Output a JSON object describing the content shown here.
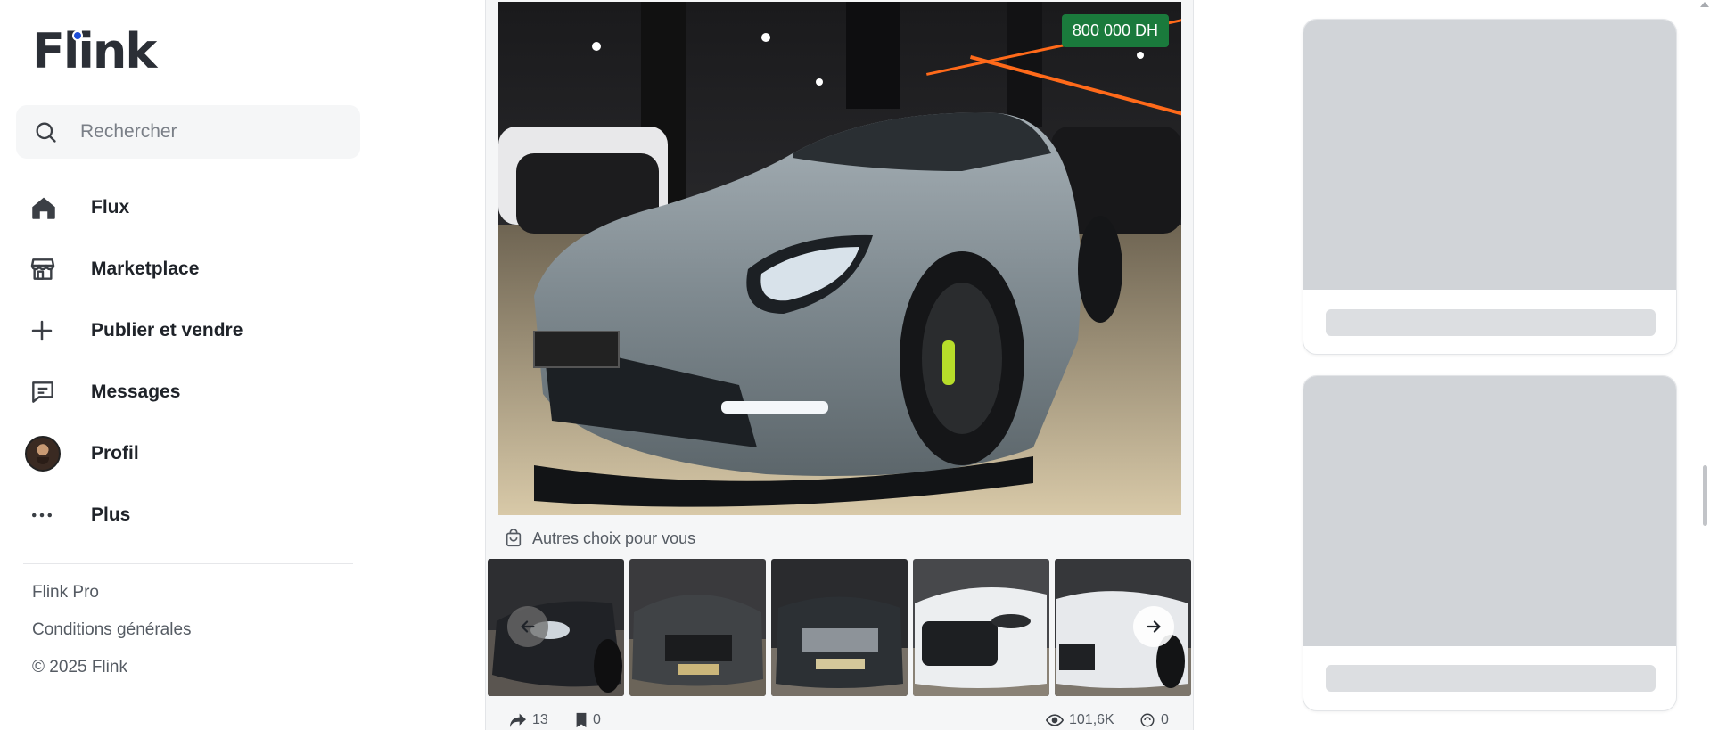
{
  "app": {
    "logo_text": "Flink"
  },
  "search": {
    "placeholder": "Rechercher"
  },
  "nav": {
    "items": [
      {
        "label": "Flux",
        "icon": "home-icon"
      },
      {
        "label": "Marketplace",
        "icon": "store-icon"
      },
      {
        "label": "Publier et vendre",
        "icon": "plus-icon"
      },
      {
        "label": "Messages",
        "icon": "message-icon"
      },
      {
        "label": "Profil",
        "icon": "avatar"
      },
      {
        "label": "Plus",
        "icon": "more-dots-icon"
      }
    ]
  },
  "footer": {
    "links": [
      "Flink Pro",
      "Conditions générales",
      "© 2025 Flink"
    ]
  },
  "post": {
    "price": "800 000 DH",
    "others_label": "Autres choix pour vous",
    "stats": {
      "shares": "13",
      "saves": "0",
      "views": "101,6K",
      "reposts": "0"
    }
  },
  "colors": {
    "price_badge": "#1a7a3c",
    "skeleton": "#d1d4d8",
    "accent_dot": "#1d4ed8"
  }
}
